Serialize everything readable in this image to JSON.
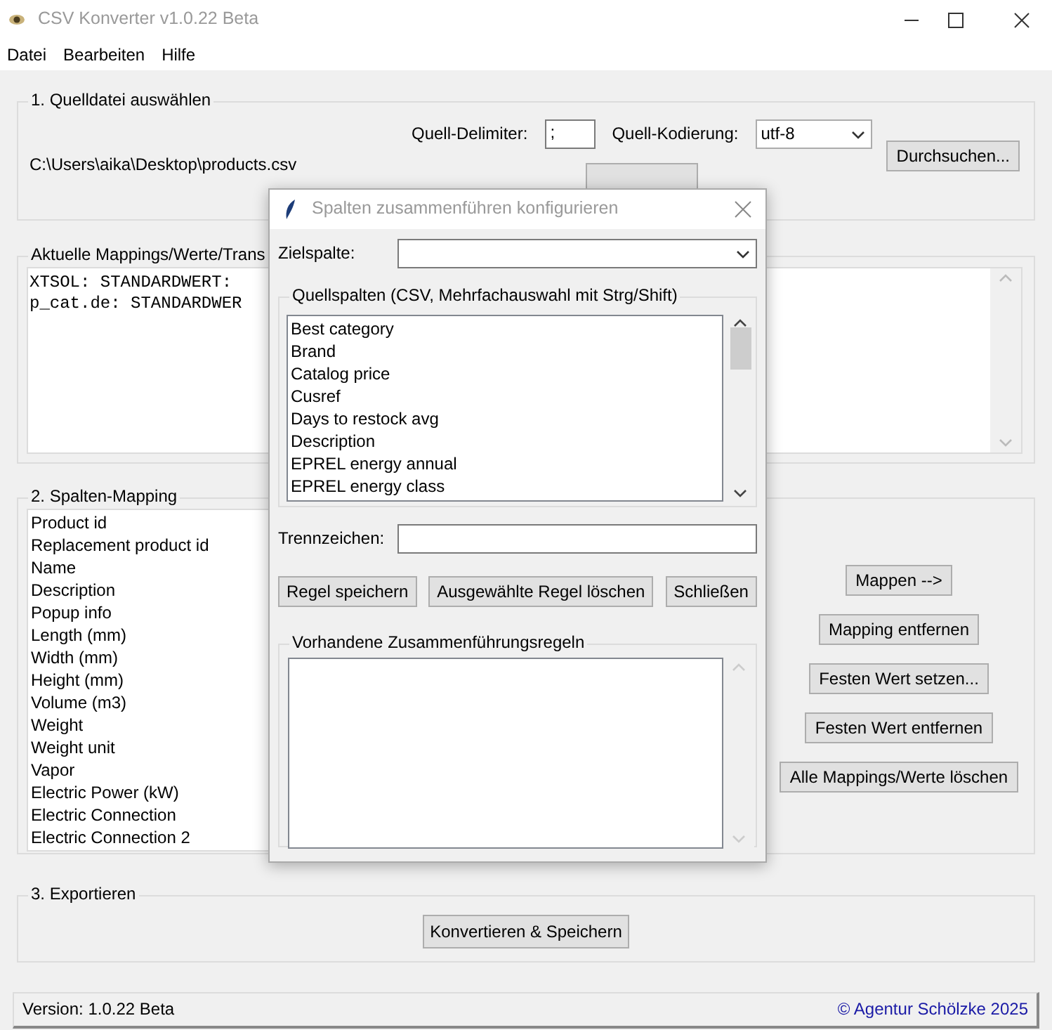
{
  "window": {
    "title": "CSV Konverter v1.0.22 Beta"
  },
  "menu": [
    "Datei",
    "Bearbeiten",
    "Hilfe"
  ],
  "source_file": {
    "title": "1. Quelldatei auswählen",
    "delimiter_label": "Quell-Delimiter:",
    "delimiter_value": ";",
    "encoding_label": "Quell-Kodierung:",
    "encoding_value": "utf-8",
    "path": "C:\\Users\\aika\\Desktop\\products.csv",
    "browse_button": "Durchsuchen..."
  },
  "current_mappings": {
    "title": "Aktuelle Mappings/Werte/Trans",
    "lines": [
      "XTSOL: STANDARDWERT:",
      "p_cat.de: STANDARDWER"
    ]
  },
  "column_mapping": {
    "title": "2. Spalten-Mapping",
    "target_columns": [
      "Product id",
      "Replacement product id",
      "Name",
      "Description",
      "Popup info",
      "Length (mm)",
      "Width (mm)",
      "Height (mm)",
      "Volume (m3)",
      "Weight",
      "Weight unit",
      "Vapor",
      "Electric Power (kW)",
      "Electric Connection",
      "Electric Connection 2"
    ],
    "buttons": [
      "Mappen -->",
      "Mapping entfernen",
      "Festen Wert setzen...",
      "Festen Wert entfernen",
      "Alle Mappings/Werte löschen"
    ]
  },
  "export": {
    "title": "3. Exportieren",
    "button": "Konvertieren & Speichern"
  },
  "status_bar": {
    "version": "Version: 1.0.22 Beta",
    "copyright": "© Agentur Schölzke 2025"
  },
  "dialog": {
    "title": "Spalten zusammenführen konfigurieren",
    "target_label": "Zielspalte:",
    "source_group": "Quellspalten (CSV, Mehrfachauswahl mit Strg/Shift)",
    "source_columns": [
      "Best category",
      "Brand",
      "Catalog price",
      "Cusref",
      "Days to restock avg",
      "Description",
      "EPREL energy annual",
      "EPREL energy class"
    ],
    "separator_label": "Trennzeichen:",
    "buttons": [
      "Regel speichern",
      "Ausgewählte Regel löschen",
      "Schließen"
    ],
    "rules_group": "Vorhandene Zusammenführungsregeln"
  }
}
